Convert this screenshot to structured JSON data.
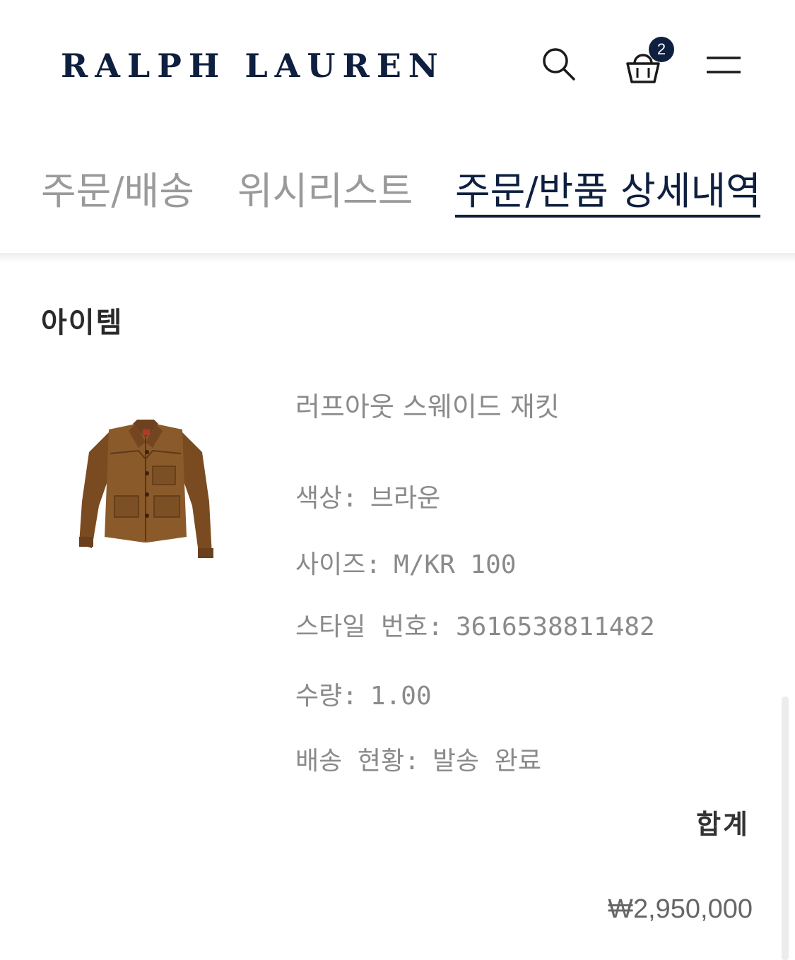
{
  "header": {
    "logo": "RALPH LAUREN",
    "cart_count": "2",
    "icons": [
      "search-icon",
      "cart-icon",
      "menu-icon"
    ]
  },
  "tabs": [
    {
      "label": "주문/배송",
      "active": false
    },
    {
      "label": "위시리스트",
      "active": false
    },
    {
      "label": "주문/반품 상세내역",
      "active": true
    }
  ],
  "section": {
    "title": "아이템"
  },
  "item": {
    "name": "러프아웃 스웨이드 재킷",
    "color_label": "색상:",
    "color_value": "브라운",
    "size_label": "사이즈:",
    "size_value": "M/KR 100",
    "style_label": "스타일 번호:",
    "style_value": "3616538811482",
    "qty_label": "수량:",
    "qty_value": "1.00",
    "ship_label": "배송 현황:",
    "ship_value": "발송 완료"
  },
  "summary": {
    "total_label": "합계",
    "total_price": "₩2,950,000"
  },
  "colors": {
    "navy": "#0e1f3f",
    "inactive_tab": "#9a9a9a",
    "detail_text": "#8a8a8a",
    "jacket_brown": "#8b5a2b"
  }
}
